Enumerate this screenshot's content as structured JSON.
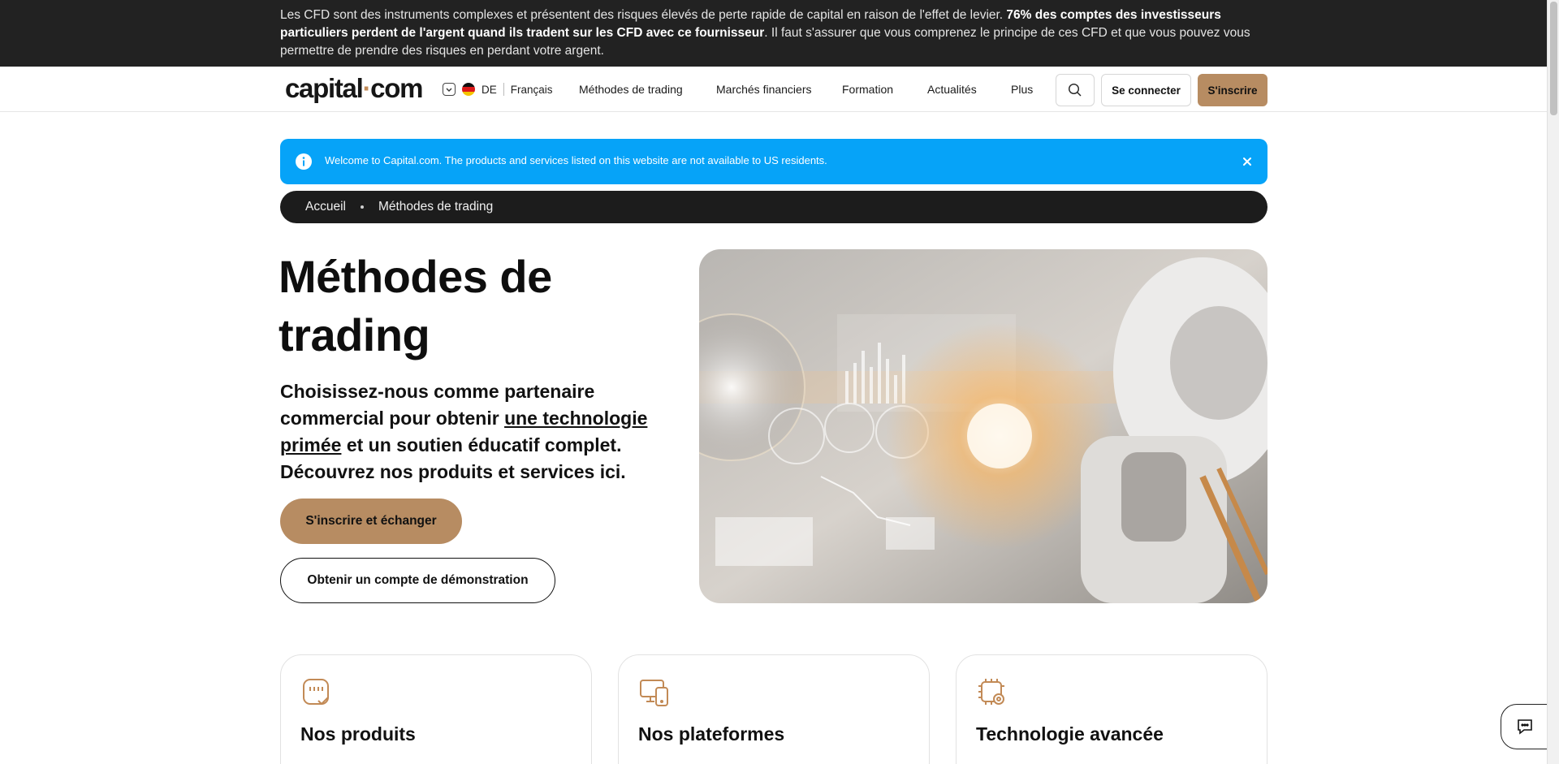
{
  "risk_banner": {
    "text_1": "Les CFD sont des instruments complexes et présentent des risques élevés de perte rapide de capital en raison de l'effet de levier. ",
    "text_bold": "76% des comptes des investisseurs particuliers perdent de l'argent quand ils tradent sur les CFD avec ce fournisseur",
    "text_2": ". Il faut s'assurer que vous comprenez le principe de ces CFD et que vous pouvez vous permettre de prendre des risques en perdant votre argent."
  },
  "header": {
    "logo_part1": "capital",
    "logo_dot": "·",
    "logo_part2": "com",
    "country_code": "DE",
    "language": "Français",
    "nav": [
      "Méthodes de trading",
      "Marchés financiers",
      "Formation",
      "Actualités",
      "Plus"
    ],
    "login_label": "Se connecter",
    "signup_label": "S'inscrire"
  },
  "alert": {
    "message": "Welcome to Capital.com. The products and services listed on this website are not available to US residents."
  },
  "breadcrumb": {
    "items": [
      "Accueil",
      "Méthodes de trading"
    ]
  },
  "hero": {
    "title": "Méthodes de trading",
    "subtitle_1": "Choisissez-nous comme partenaire commercial pour obtenir ",
    "subtitle_link": "une technologie primée",
    "subtitle_2": " et un soutien éducatif complet. Découvrez nos produits et services ici.",
    "cta_primary": "S'inscrire et échanger",
    "cta_demo": "Obtenir un compte de démonstration"
  },
  "cards": [
    {
      "title": "Nos produits",
      "icon": "products-icon"
    },
    {
      "title": "Nos plateformes",
      "icon": "platforms-icon"
    },
    {
      "title": "Technologie avancée",
      "icon": "technology-icon"
    }
  ],
  "colors": {
    "accent": "#b78c62",
    "banner_bg": "#222222",
    "alert_bg": "#06a3f8",
    "breadcrumb_bg": "#1c1c1c",
    "icon_orange": "#c28a56"
  }
}
